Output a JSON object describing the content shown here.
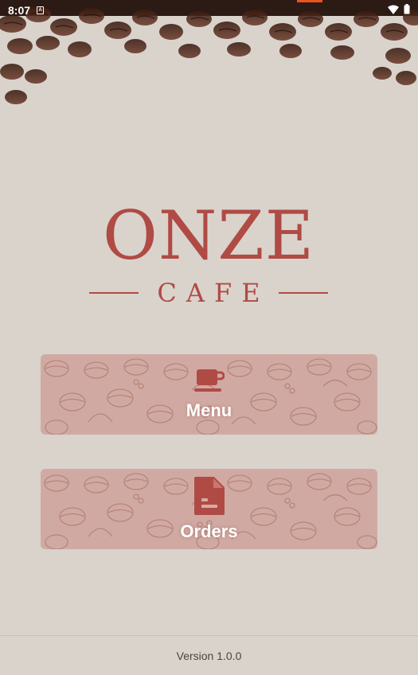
{
  "status_bar": {
    "time": "8:07",
    "notification_icon": "a-icon",
    "wifi_icon": "wifi-icon",
    "battery_icon": "battery-icon"
  },
  "logo": {
    "main": "ONZE",
    "sub": "CAFE",
    "color": "#b04a45"
  },
  "menu_card": {
    "label": "Menu",
    "icon": "cup-icon"
  },
  "orders_card": {
    "label": "Orders",
    "icon": "document-icon"
  },
  "footer": {
    "version": "Version 1.0.0"
  },
  "colors": {
    "background": "#d9d3cc",
    "card": "#d0aaa2",
    "accent": "#b04a45"
  }
}
